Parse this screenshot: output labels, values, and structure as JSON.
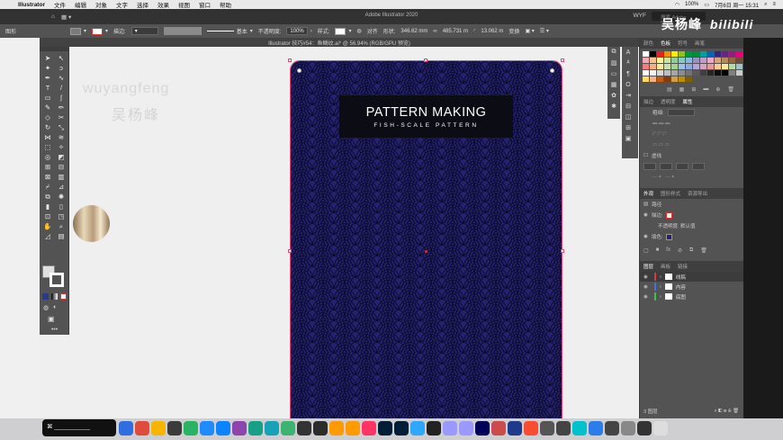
{
  "menubar": {
    "items": [
      "Illustrator",
      "文件",
      "编辑",
      "对象",
      "文字",
      "选择",
      "效果",
      "视图",
      "窗口",
      "帮助"
    ],
    "status_right": [
      "100%",
      "7月6日 周一 15:31"
    ]
  },
  "appbar": {
    "title": "Adobe Illustrator 2020",
    "workspace": "WYF",
    "search_placeholder": "搜索 Adobe Stock"
  },
  "controlbar": {
    "label_left": "图形",
    "stroke_label": "描边:",
    "brush_label": "基本",
    "opacity_label": "不透明度:",
    "opacity_value": "100%",
    "style_label": "样式:",
    "align_label": "对齐",
    "shape_label": "形状:",
    "width_value": "346.62 mm",
    "height_value": "485.731 m",
    "corner_value": "13.062 m",
    "transform_label": "变换"
  },
  "document_tab": {
    "title": "Illustrator 技巧#54：鱼鳞纹.ai* @ 56.94% (RGB/GPU 预览)"
  },
  "canvas": {
    "watermark_pinyin": "wuyangfeng",
    "watermark_cn": "吴杨峰"
  },
  "artwork": {
    "title": "PATTERN MAKING",
    "subtitle": "FISH-SCALE PATTERN",
    "pattern_color_bg": "#24226e",
    "pattern_color_line": "#0d0c30"
  },
  "panels": {
    "swatch_tabs": [
      "颜色",
      "色板",
      "符号",
      "画笔"
    ],
    "props_tabs": [
      "描边",
      "透明度",
      "属性"
    ],
    "weight_label": "粗细:",
    "dashed_label": "虚线",
    "appearance_tabs": [
      "外观",
      "图形样式",
      "资源导出"
    ],
    "appearance_rows": {
      "path": "路径",
      "stroke": "描边:",
      "opacity": "不透明度: 默认值",
      "fill": "填色:"
    },
    "layers_tabs": [
      "图层",
      "画板",
      "链接"
    ],
    "layers": [
      "线稿",
      "内容",
      "底图"
    ],
    "layers_count": "3 图层"
  },
  "brand": {
    "text": "吴杨峰",
    "logo": "bilibili"
  },
  "dock": {
    "shell_label": "⌘ ___________"
  }
}
